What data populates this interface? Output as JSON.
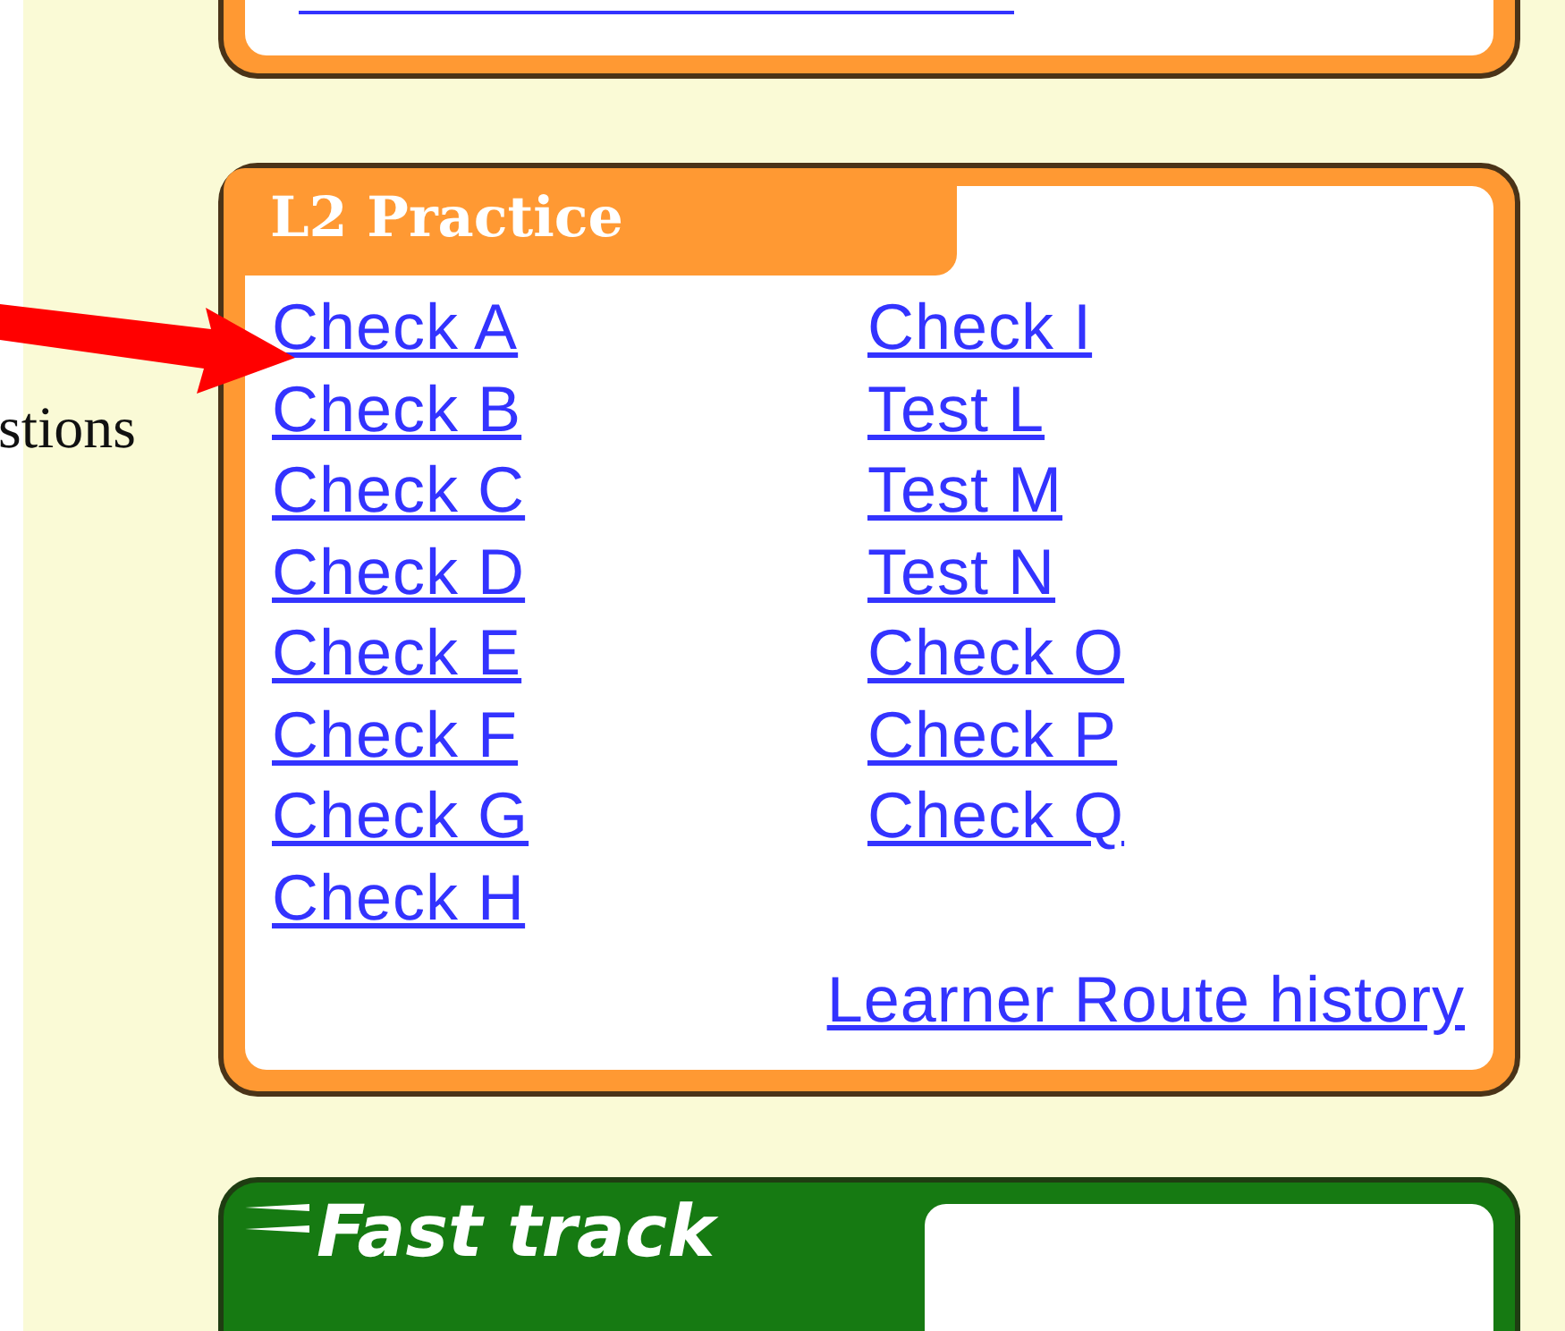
{
  "side_note": {
    "text": "stions"
  },
  "practice_panel": {
    "title": "L2 Practice",
    "link_columns": [
      [
        "Check A",
        "Check B",
        "Check C",
        "Check D",
        "Check E",
        "Check F",
        "Check G",
        "Check H"
      ],
      [
        "Check I",
        "Test L",
        "Test M",
        "Test N",
        "Check O",
        "Check P",
        "Check Q"
      ]
    ],
    "footer_link": "Learner Route history"
  },
  "fast_track_panel": {
    "title": "Fast track"
  }
}
